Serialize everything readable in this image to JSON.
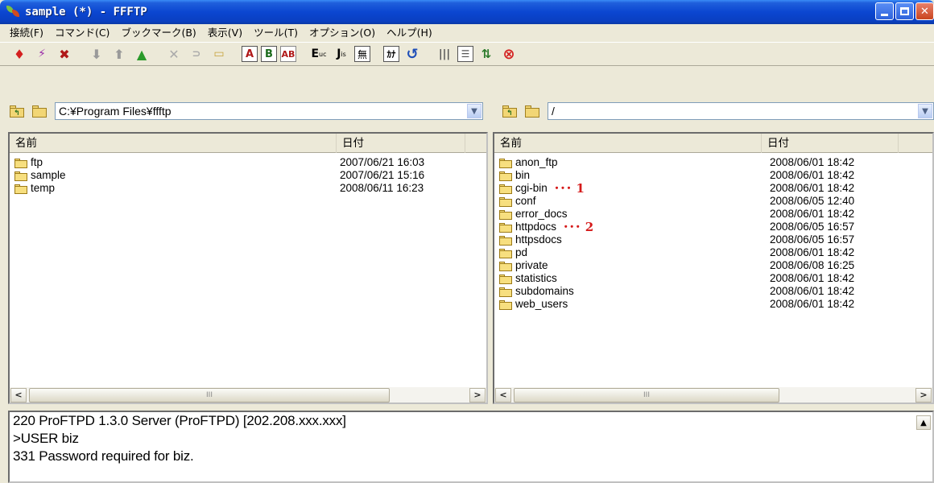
{
  "window": {
    "title": "sample (*) - FFFTP"
  },
  "menu": [
    {
      "label": "接続(F)"
    },
    {
      "label": "コマンド(C)"
    },
    {
      "label": "ブックマーク(B)"
    },
    {
      "label": "表示(V)"
    },
    {
      "label": "ツール(T)"
    },
    {
      "label": "オプション(O)"
    },
    {
      "label": "ヘルプ(H)"
    }
  ],
  "toolbar": {
    "icons": [
      "connect-icon",
      "quick-connect-icon",
      "disconnect-icon",
      "download-icon",
      "upload-icon",
      "mirror-upload-icon",
      "delete-icon",
      "rename-icon",
      "mkdir-icon",
      "ascii-mode-icon",
      "binary-mode-icon",
      "auto-mode-icon",
      "euc-icon",
      "jis-icon",
      "no-convert-icon",
      "kana-convert-icon",
      "refresh-icon",
      "list-view-icon",
      "detail-view-icon",
      "sync-icon",
      "stop-icon"
    ],
    "labels": {
      "ascii": "A",
      "binary": "B",
      "euc": "E",
      "euc_sub": "uc",
      "jis": "J",
      "jis_sub": "is",
      "noconv": "無",
      "kana": "ｶﾅ"
    }
  },
  "local": {
    "path": "C:¥Program Files¥ffftp",
    "col_name": "名前",
    "col_date": "日付",
    "files": [
      {
        "name": "ftp",
        "date": "2007/06/21 16:03"
      },
      {
        "name": "sample",
        "date": "2007/06/21 15:16"
      },
      {
        "name": "temp",
        "date": "2008/06/11 16:23"
      }
    ]
  },
  "remote": {
    "path": "/",
    "col_name": "名前",
    "col_date": "日付",
    "files": [
      {
        "name": "anon_ftp",
        "date": "2008/06/01 18:42",
        "annotation": ""
      },
      {
        "name": "bin",
        "date": "2008/06/01 18:42",
        "annotation": ""
      },
      {
        "name": "cgi-bin",
        "date": "2008/06/01 18:42",
        "annotation": "･･･ 1"
      },
      {
        "name": "conf",
        "date": "2008/06/05 12:40",
        "annotation": ""
      },
      {
        "name": "error_docs",
        "date": "2008/06/01 18:42",
        "annotation": ""
      },
      {
        "name": "httpdocs",
        "date": "2008/06/05 16:57",
        "annotation": "･･･ 2"
      },
      {
        "name": "httpsdocs",
        "date": "2008/06/05 16:57",
        "annotation": ""
      },
      {
        "name": "pd",
        "date": "2008/06/01 18:42",
        "annotation": ""
      },
      {
        "name": "private",
        "date": "2008/06/08 16:25",
        "annotation": ""
      },
      {
        "name": "statistics",
        "date": "2008/06/01 18:42",
        "annotation": ""
      },
      {
        "name": "subdomains",
        "date": "2008/06/01 18:42",
        "annotation": ""
      },
      {
        "name": "web_users",
        "date": "2008/06/01 18:42",
        "annotation": ""
      }
    ]
  },
  "log": {
    "lines": [
      "220 ProFTPD 1.3.0 Server (ProFTPD) [202.208.xxx.xxx]",
      ">USER biz",
      "331 Password required for biz."
    ]
  },
  "colors": {
    "titlebar": "#0b46d1",
    "annotation": "#d51a1a",
    "folder": "#f7df7f"
  }
}
